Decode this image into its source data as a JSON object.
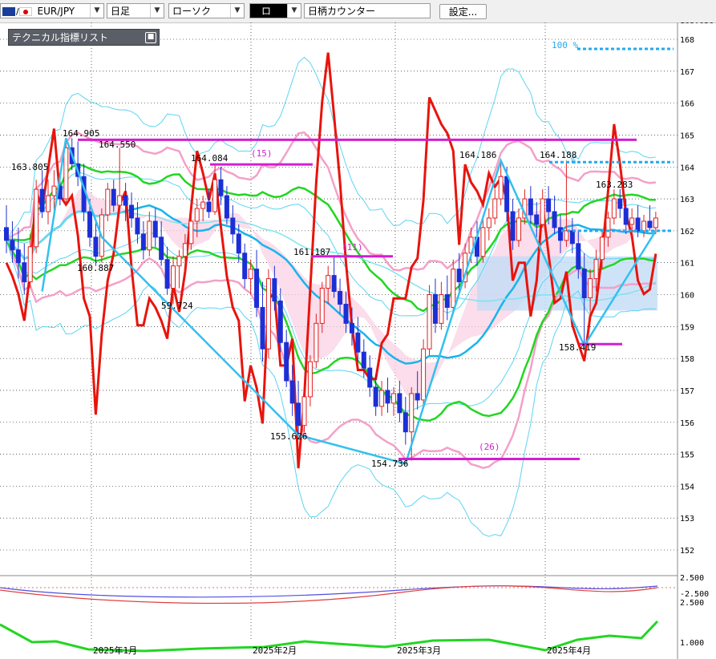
{
  "toolbar": {
    "symbol": "EUR/JPY",
    "timeframe": "日足",
    "chart_type": "ローソク",
    "draw_tool": "ロ",
    "counter_label": "日柄カウンター",
    "settings_label": "設定..."
  },
  "indicator_panel": {
    "title": "テクニカル指標リスト"
  },
  "price_axis": [
    "168",
    "167",
    "166",
    "165",
    "164",
    "163",
    "162",
    "161",
    "160",
    "159",
    "158",
    "157",
    "156",
    "155",
    "154",
    "153",
    "152"
  ],
  "price_axis_top_partial": "168.036",
  "sub_axis": {
    "upper": "2.500",
    "middle": "-2.500",
    "lower": "2.500",
    "bottom": "1.000"
  },
  "date_axis": [
    "2025年1月",
    "2025年2月",
    "2025年3月",
    "2025年4月"
  ],
  "annotations": {
    "high_1": "164.905",
    "high_2": "164.550",
    "high_3": "164.084",
    "high_4": "163.805",
    "low_1": "160.887",
    "low_2": "59.724",
    "low_3": "161.187",
    "low_4": "155.626",
    "low_5": "154.736",
    "high_5": "164.186",
    "high_6": "164.188",
    "high_7": "163.283",
    "low_6": "158.419",
    "count_15": "(15)",
    "count_26": "(26)",
    "count_mid": "(11)",
    "fib_100": "100 %",
    "fib_mark": "%"
  },
  "colors": {
    "bull": "#e02020",
    "bear": "#1c2fd6",
    "rsi": "#e8140c",
    "ma_green": "#22d622",
    "ma_cyan": "#18b4ec",
    "bb_pink": "#f4a0c8",
    "bb_cyan": "#5cd4f2",
    "magenta": "#d21ed2",
    "cloud_pink": "#f9cfe2",
    "cloud_blue": "#c3dcf6"
  },
  "chart_data": {
    "type": "candlestick",
    "symbol": "EUR/JPY",
    "timeframe": "日足",
    "ylim": [
      151.5,
      168.2
    ],
    "x_range_bars": [
      0,
      114
    ],
    "candles": [
      [
        0,
        162.1,
        162.8,
        161.3,
        161.7
      ],
      [
        1,
        161.7,
        162.3,
        161.0,
        161.4
      ],
      [
        2,
        161.4,
        162.1,
        160.5,
        161.0
      ],
      [
        3,
        161.0,
        161.6,
        160.0,
        160.4
      ],
      [
        4,
        160.4,
        161.9,
        160.2,
        161.5
      ],
      [
        5,
        161.5,
        163.6,
        161.3,
        163.3
      ],
      [
        6,
        163.3,
        163.9,
        162.4,
        162.6
      ],
      [
        7,
        162.6,
        163.6,
        162.2,
        163.1
      ],
      [
        8,
        163.1,
        163.9,
        162.6,
        163.4
      ],
      [
        9,
        163.4,
        163.8,
        162.8,
        163.0
      ],
      [
        10,
        163.0,
        164.8,
        162.9,
        164.6
      ],
      [
        11,
        164.6,
        164.9,
        163.9,
        164.1
      ],
      [
        12,
        164.1,
        164.8,
        163.4,
        163.7
      ],
      [
        13,
        163.7,
        164.1,
        162.3,
        162.6
      ],
      [
        14,
        162.6,
        163.0,
        161.5,
        161.8
      ],
      [
        15,
        161.8,
        162.3,
        160.9,
        161.2
      ],
      [
        16,
        161.2,
        162.7,
        161.0,
        162.5
      ],
      [
        17,
        162.5,
        163.5,
        162.3,
        163.3
      ],
      [
        18,
        163.3,
        163.6,
        162.6,
        162.8
      ],
      [
        19,
        162.8,
        164.6,
        162.7,
        163.1
      ],
      [
        20,
        163.1,
        163.5,
        162.3,
        162.8
      ],
      [
        21,
        162.8,
        163.2,
        162.1,
        162.4
      ],
      [
        22,
        162.4,
        162.9,
        161.6,
        161.9
      ],
      [
        23,
        161.9,
        162.3,
        161.1,
        161.4
      ],
      [
        24,
        161.4,
        162.6,
        161.2,
        162.3
      ],
      [
        25,
        162.3,
        162.7,
        161.5,
        161.8
      ],
      [
        26,
        161.8,
        162.3,
        160.9,
        161.1
      ],
      [
        27,
        161.1,
        161.5,
        160.0,
        160.2
      ],
      [
        28,
        160.2,
        161.2,
        159.7,
        160.9
      ],
      [
        29,
        160.9,
        161.4,
        160.2,
        161.2
      ],
      [
        30,
        161.2,
        161.9,
        160.6,
        161.6
      ],
      [
        31,
        161.6,
        162.6,
        161.4,
        162.3
      ],
      [
        32,
        162.3,
        163.0,
        161.8,
        162.7
      ],
      [
        33,
        162.7,
        163.1,
        162.3,
        162.9
      ],
      [
        34,
        162.9,
        163.3,
        162.4,
        162.6
      ],
      [
        35,
        162.6,
        164.1,
        162.5,
        163.6
      ],
      [
        36,
        163.6,
        164.0,
        162.8,
        163.1
      ],
      [
        37,
        163.1,
        163.4,
        162.2,
        162.4
      ],
      [
        38,
        162.4,
        162.8,
        161.6,
        161.9
      ],
      [
        39,
        161.9,
        162.2,
        161.0,
        161.3
      ],
      [
        40,
        161.3,
        161.6,
        160.2,
        160.5
      ],
      [
        41,
        160.5,
        161.1,
        160.0,
        160.8
      ],
      [
        42,
        160.8,
        161.4,
        159.3,
        159.6
      ],
      [
        43,
        159.6,
        160.4,
        157.9,
        158.3
      ],
      [
        44,
        158.3,
        160.8,
        158.0,
        160.5
      ],
      [
        45,
        160.5,
        160.9,
        159.5,
        159.8
      ],
      [
        46,
        159.8,
        160.2,
        158.2,
        158.5
      ],
      [
        47,
        158.5,
        158.9,
        157.1,
        157.3
      ],
      [
        48,
        157.3,
        157.8,
        156.2,
        156.6
      ],
      [
        49,
        156.6,
        157.3,
        155.6,
        155.9
      ],
      [
        50,
        155.9,
        157.0,
        155.7,
        156.8
      ],
      [
        51,
        156.8,
        158.1,
        156.5,
        157.9
      ],
      [
        52,
        157.9,
        159.4,
        157.7,
        159.1
      ],
      [
        53,
        159.1,
        160.4,
        158.8,
        160.2
      ],
      [
        54,
        160.2,
        160.9,
        159.7,
        160.6
      ],
      [
        55,
        160.6,
        161.2,
        159.9,
        160.1
      ],
      [
        56,
        160.1,
        160.5,
        159.4,
        159.7
      ],
      [
        57,
        159.7,
        160.1,
        158.8,
        159.1
      ],
      [
        58,
        159.1,
        159.6,
        158.4,
        158.8
      ],
      [
        59,
        158.8,
        159.3,
        157.9,
        158.2
      ],
      [
        60,
        158.2,
        158.6,
        157.4,
        157.7
      ],
      [
        61,
        157.7,
        158.1,
        156.8,
        157.1
      ],
      [
        62,
        157.1,
        157.5,
        156.2,
        156.5
      ],
      [
        63,
        156.5,
        157.3,
        156.2,
        157.0
      ],
      [
        64,
        157.0,
        157.4,
        156.3,
        156.6
      ],
      [
        65,
        156.6,
        157.1,
        156.2,
        156.9
      ],
      [
        66,
        156.9,
        157.3,
        156.0,
        156.3
      ],
      [
        67,
        156.3,
        156.8,
        155.3,
        155.7
      ],
      [
        68,
        155.7,
        157.1,
        154.8,
        156.9
      ],
      [
        69,
        156.9,
        157.6,
        156.4,
        156.7
      ],
      [
        70,
        156.7,
        158.6,
        156.5,
        158.3
      ],
      [
        71,
        158.3,
        160.3,
        158.1,
        160.0
      ],
      [
        72,
        160.0,
        160.5,
        158.8,
        159.1
      ],
      [
        73,
        159.1,
        160.4,
        158.9,
        160.0
      ],
      [
        74,
        160.0,
        160.6,
        159.2,
        159.6
      ],
      [
        75,
        159.6,
        161.1,
        159.4,
        160.8
      ],
      [
        76,
        160.8,
        161.3,
        160.0,
        160.4
      ],
      [
        77,
        160.4,
        161.6,
        160.2,
        161.3
      ],
      [
        78,
        161.3,
        162.1,
        161.0,
        161.8
      ],
      [
        79,
        161.8,
        162.3,
        160.9,
        161.2
      ],
      [
        80,
        161.2,
        162.4,
        161.0,
        162.1
      ],
      [
        81,
        162.1,
        162.7,
        161.7,
        162.4
      ],
      [
        82,
        162.4,
        163.3,
        162.2,
        163.0
      ],
      [
        83,
        163.0,
        164.2,
        162.8,
        163.7
      ],
      [
        84,
        163.7,
        164.0,
        162.3,
        162.6
      ],
      [
        85,
        162.6,
        163.0,
        161.4,
        161.7
      ],
      [
        86,
        161.7,
        162.7,
        161.5,
        162.4
      ],
      [
        87,
        162.4,
        163.3,
        162.2,
        163.0
      ],
      [
        88,
        163.0,
        163.4,
        162.2,
        162.5
      ],
      [
        89,
        162.5,
        162.9,
        161.8,
        162.2
      ],
      [
        90,
        162.2,
        163.3,
        162.1,
        163.0
      ],
      [
        91,
        163.0,
        163.4,
        162.2,
        162.6
      ],
      [
        92,
        162.6,
        163.1,
        161.9,
        162.1
      ],
      [
        93,
        162.1,
        162.5,
        161.3,
        161.7
      ],
      [
        94,
        161.7,
        164.2,
        161.5,
        162.0
      ],
      [
        95,
        162.0,
        162.4,
        161.3,
        161.6
      ],
      [
        96,
        161.6,
        162.0,
        160.5,
        160.8
      ],
      [
        97,
        160.8,
        161.3,
        158.4,
        159.9
      ],
      [
        98,
        159.9,
        160.8,
        159.4,
        160.5
      ],
      [
        99,
        160.5,
        161.4,
        160.1,
        161.1
      ],
      [
        100,
        161.1,
        162.0,
        160.8,
        161.8
      ],
      [
        101,
        161.8,
        162.6,
        161.5,
        162.4
      ],
      [
        102,
        162.4,
        163.3,
        162.2,
        163.0
      ],
      [
        103,
        163.0,
        163.3,
        162.4,
        162.7
      ],
      [
        104,
        162.7,
        163.0,
        161.9,
        162.2
      ],
      [
        105,
        162.2,
        162.7,
        161.7,
        162.4
      ],
      [
        106,
        162.4,
        162.8,
        161.8,
        162.0
      ],
      [
        107,
        162.0,
        162.5,
        161.8,
        162.3
      ],
      [
        108,
        162.3,
        162.8,
        162.0,
        162.1
      ],
      [
        109,
        162.1,
        162.6,
        161.9,
        162.4
      ]
    ]
  }
}
